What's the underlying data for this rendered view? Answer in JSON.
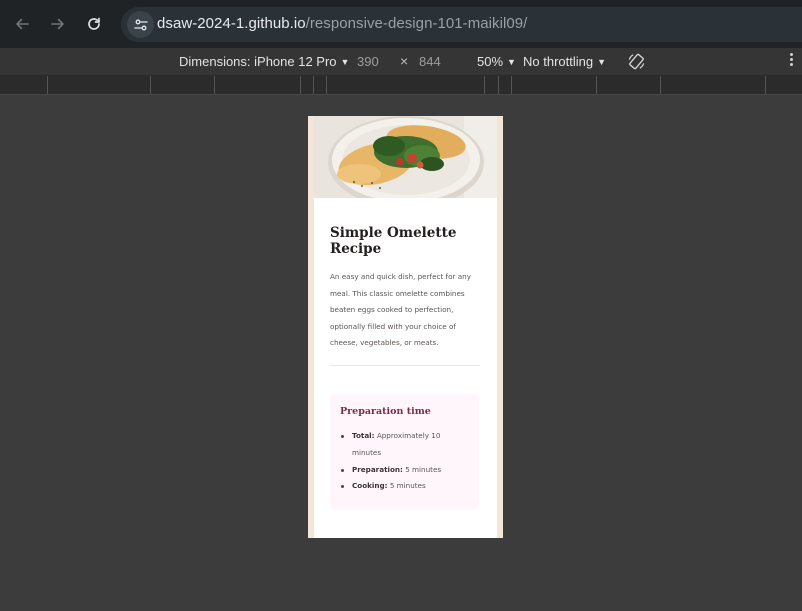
{
  "browser": {
    "url_host": "dsaw-2024-1.github.io",
    "url_path": "/responsive-design-101-maikil09/"
  },
  "devtools": {
    "dimensions_label": "Dimensions: iPhone 12 Pro",
    "width": "390",
    "times": "×",
    "height": "844",
    "zoom": "50%",
    "throttling": "No throttling",
    "icons": {
      "rotate": "rotate-icon",
      "more": "more-options-icon",
      "caret": "caret-down-icon"
    }
  },
  "page": {
    "image_alt": "omelette-image",
    "title": "Simple Omelette Recipe",
    "description": "An easy and quick dish, perfect for any meal. This classic omelette combines beaten eggs cooked to perfection, optionally filled with your choice of cheese, vegetables, or meats.",
    "preparation": {
      "title": "Preparation time",
      "items": [
        {
          "label": "Total:",
          "value": "Approximately 10 minutes"
        },
        {
          "label": "Preparation:",
          "value": "5 minutes"
        },
        {
          "label": "Cooking:",
          "value": "5 minutes"
        }
      ]
    }
  },
  "colors": {
    "viewport_bg": "#f3e5d8",
    "card_bg": "#ffffff",
    "accent": "#7a2c4a",
    "prep_bg": "#fff6fb"
  }
}
